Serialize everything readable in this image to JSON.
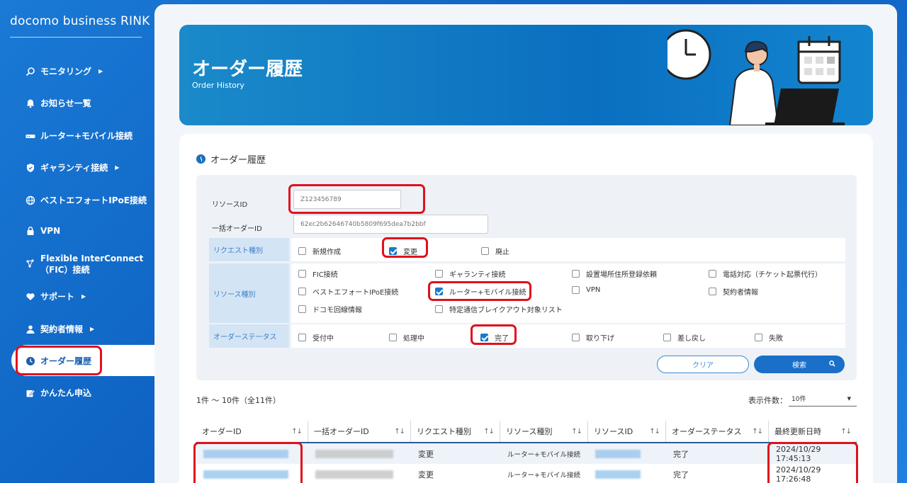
{
  "sidebar": {
    "brand": "docomo business RINK",
    "items": [
      {
        "label": "モニタリング",
        "icon": "monitor-search-icon",
        "has_chevron": true
      },
      {
        "label": "お知らせ一覧",
        "icon": "bell-icon",
        "has_chevron": false
      },
      {
        "label": "ルーター+モバイル接続",
        "icon": "router-icon",
        "has_chevron": false
      },
      {
        "label": "ギャランティ接続",
        "icon": "shield-icon",
        "has_chevron": true
      },
      {
        "label": "ベストエフォートIPoE接続",
        "icon": "globe-icon",
        "has_chevron": false
      },
      {
        "label": "VPN",
        "icon": "lock-icon",
        "has_chevron": false
      },
      {
        "label": "Flexible InterConnect",
        "label2": "（FIC）接続",
        "icon": "network-icon",
        "has_chevron": false
      },
      {
        "label": "サポート",
        "icon": "heart-hand-icon",
        "has_chevron": true
      },
      {
        "label": "契約者情報",
        "icon": "person-icon",
        "has_chevron": true
      },
      {
        "label": "オーダー履歴",
        "icon": "clock-icon",
        "has_chevron": false,
        "active": true
      },
      {
        "label": "かんたん申込",
        "icon": "edit-icon",
        "has_chevron": false
      }
    ]
  },
  "hero": {
    "title": "オーダー履歴",
    "subtitle": "Order History"
  },
  "section": {
    "title": "オーダー履歴"
  },
  "filters": {
    "resource_id": {
      "label": "リソースID",
      "placeholder": "Z123456789"
    },
    "bulk_order_id": {
      "label": "一括オーダーID",
      "placeholder": "62ec2b62646740b5809f695dea7b2bbf"
    },
    "request_type": {
      "label": "リクエスト種別",
      "options": [
        {
          "label": "新規作成",
          "checked": false
        },
        {
          "label": "変更",
          "checked": true
        },
        {
          "label": "廃止",
          "checked": false
        }
      ]
    },
    "resource_type": {
      "label": "リソース種別",
      "options": [
        {
          "label": "FIC接続",
          "checked": false
        },
        {
          "label": "ギャランティ接続",
          "checked": false
        },
        {
          "label": "設置場所住所登録依頼",
          "checked": false
        },
        {
          "label": "電話対応（チケット起票代行）",
          "checked": false
        },
        {
          "label": "ベストエフォートIPoE接続",
          "checked": false
        },
        {
          "label": "ルーター+モバイル接続",
          "checked": true
        },
        {
          "label": "VPN",
          "checked": false
        },
        {
          "label": "契約者情報",
          "checked": false
        },
        {
          "label": "ドコモ回線情報",
          "checked": false
        },
        {
          "label": "特定通信ブレイクアウト対象リスト",
          "checked": false
        }
      ]
    },
    "order_status": {
      "label": "オーダーステータス",
      "options": [
        {
          "label": "受付中",
          "checked": false
        },
        {
          "label": "処理中",
          "checked": false
        },
        {
          "label": "完了",
          "checked": true
        },
        {
          "label": "取り下げ",
          "checked": false
        },
        {
          "label": "差し戻し",
          "checked": false
        },
        {
          "label": "失敗",
          "checked": false
        }
      ]
    },
    "clear_label": "クリア",
    "search_label": "検索"
  },
  "results": {
    "count_text": "1件 〜 10件（全11件）",
    "per_page_label": "表示件数：",
    "per_page_value": "10件",
    "sort_glyph": "↑↓",
    "columns": [
      "オーダーID",
      "一括オーダーID",
      "リクエスト種別",
      "リソース種別",
      "リソースID",
      "オーダーステータス",
      "最終更新日時"
    ],
    "rows": [
      {
        "request_type": "変更",
        "resource_type": "ルーター+モバイル接続",
        "status": "完了",
        "updated": "2024/10/29 17:45:13"
      },
      {
        "request_type": "変更",
        "resource_type": "ルーター+モバイル接続",
        "status": "完了",
        "updated": "2024/10/29 17:26:48"
      }
    ]
  },
  "colors": {
    "accent": "#1a6fc8",
    "highlight_outline": "#e0101c",
    "row_label_bg": "#d3e4f5"
  }
}
